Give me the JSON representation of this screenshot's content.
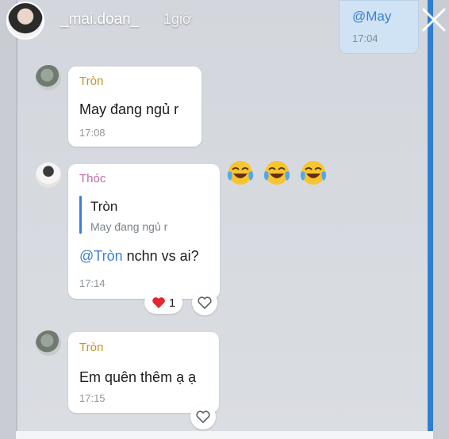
{
  "story": {
    "username": "_mai.doan_",
    "time": "1giờ"
  },
  "top_bubble": {
    "mention": "@May",
    "time": "17:04"
  },
  "messages": [
    {
      "sender": "Tròn",
      "text": "May đang ngủ r",
      "time": "17:08"
    },
    {
      "sender": "Thóc",
      "quote_name": "Tròn",
      "quote_text": "May đang ngủ r",
      "mention": "@Tròn",
      "text": " nchn vs ai?",
      "time": "17:14",
      "reaction_count": "1"
    },
    {
      "sender": "Tròn",
      "text": "Em quên thêm ạ ạ",
      "time": "17:15"
    }
  ],
  "colors": {
    "accent_blue": "#3b7fd4",
    "sender_tron": "#c8921f",
    "sender_thoc": "#c26aa6"
  },
  "icons": [
    "close-icon",
    "laughing-emoji-icon",
    "heart-icon",
    "like-icon"
  ]
}
